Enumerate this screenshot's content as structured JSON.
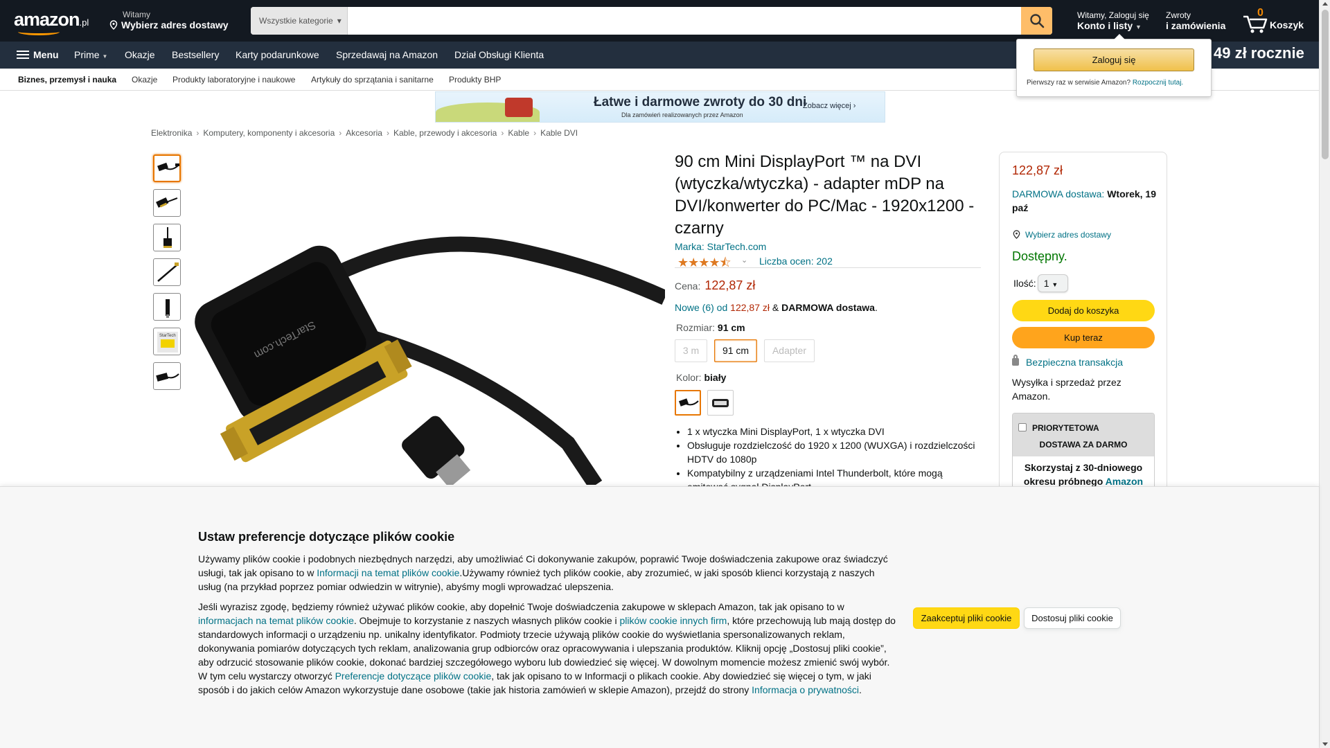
{
  "header": {
    "logo_text": "amazon",
    "logo_tld": ".pl",
    "deliver_line1": "Witamy",
    "deliver_line2": "Wybierz adres dostawy",
    "search_category": "Wszystkie kategorie",
    "search_placeholder": "",
    "account_line1": "Witamy, Zaloguj się",
    "account_line2": "Konto i listy",
    "returns_line1": "Zwroty",
    "returns_line2": "i zamówienia",
    "cart_count": "0",
    "cart_label": "Koszyk",
    "accent_color": "#febd69"
  },
  "nav": {
    "menu": "Menu",
    "prime": "Prime",
    "deals": "Okazje",
    "bestsellers": "Bestsellery",
    "gift_cards": "Karty podarunkowe",
    "sell": "Sprzedawaj na Amazon",
    "customer_service": "Dział Obsługi Klienta",
    "promo": "49 zł rocznie"
  },
  "subnav": {
    "items": [
      "Biznes, przemysł i nauka",
      "Okazje",
      "Produkty laboratoryjne i naukowe",
      "Artykuły do sprzątania i sanitarne",
      "Produkty BHP"
    ]
  },
  "banner": {
    "title": "Łatwe i darmowe zwroty do 30 dni",
    "subtitle": "Dla zamówień realizowanych przez Amazon",
    "cta": "Zobacz więcej ›"
  },
  "breadcrumb": [
    "Elektronika",
    "Komputery, komponenty i akcesoria",
    "Akcesoria",
    "Kable, przewody i akcesoria",
    "Kable",
    "Kable DVI"
  ],
  "product": {
    "title": "90 cm Mini DisplayPort ™ na DVI (wtyczka/wtyczka) - adapter mDP na DVI/konwerter do PC/Mac - 1920x1200 - czarny",
    "brand": "Marka: StarTech.com",
    "rating_stars": 4.5,
    "rating_count": "Liczba ocen: 202",
    "price_label": "Cena:",
    "price": "122,87 zł",
    "offers_prefix": "Nowe (6) od",
    "offers_price": "122,87 zł",
    "offers_amp": "&",
    "offers_free": "DARMOWA dostawa",
    "size_label": "Rozmiar:",
    "size_value": "91 cm",
    "size_options": [
      "3 m",
      "91 cm",
      "Adapter"
    ],
    "color_label": "Kolor:",
    "color_value": "biały",
    "bullets": [
      "1 x wtyczka Mini DisplayPort, 1 x wtyczka DVI",
      "Obsługuje rozdzielczość do 1920 x 1200 (WUXGA) i rozdzielczości HDTV do 1080p",
      "Kompatybilny z urządzeniami Intel Thunderbolt, które mogą emitować sygnał DisplayPort"
    ]
  },
  "buybox": {
    "price": "122,87 zł",
    "delivery_prefix": "DARMOWA dostawa:",
    "delivery_date": "Wtorek, 19 paź",
    "address_link": "Wybierz adres dostawy",
    "stock": "Dostępny.",
    "qty_label": "Ilość:",
    "qty_value": "1",
    "add_to_cart": "Dodaj do koszyka",
    "buy_now": "Kup teraz",
    "secure": "Bezpieczna transakcja",
    "shipped_by": "Wysyłka i sprzedaż przez Amazon.",
    "prime_line1": "PRIORYTETOWA",
    "prime_line2": "DOSTAWA ZA DARMO",
    "prime_body": "Skorzystaj z 30-dniowego okresu próbnego",
    "prime_link": "Amazon"
  },
  "flyout": {
    "signin": "Zaloguj się",
    "new_customer": "Pierwszy raz w serwisie Amazon?",
    "start_here": "Rozpocznij tutaj."
  },
  "cookie": {
    "title": "Ustaw preferencje dotyczące plików cookie",
    "p1_a": "Używamy plików cookie i podobnych niezbędnych narzędzi, aby umożliwiać Ci dokonywanie zakupów, poprawić Twoje doświadczenia zakupowe oraz świadczyć usługi, tak jak opisano to w ",
    "p1_link": "Informacji na temat plików cookie",
    "p1_b": ".Używamy również tych plików cookie, aby zrozumieć, w jaki sposób klienci korzystają z naszych usług (na przykład poprzez pomiar odwiedzin w witrynie), abyśmy mogli wprowadzać ulepszenia.",
    "p2_a": "Jeśli wyrazisz zgodę, będziemy również używać plików cookie, aby dopełnić Twoje doświadczenia zakupowe w sklepach Amazon, tak jak opisano to w ",
    "p2_link1": "informacjach na temat plików cookie",
    "p2_b": ". Obejmuje to korzystanie z naszych własnych plików cookie i ",
    "p2_link2": "plików cookie innych firm",
    "p2_c": ", które przechowują lub mają dostęp do standardowych informacji o urządzeniu np. unikalny identyfikator. Podmioty trzecie używają plików cookie do wyświetlania spersonalizowanych reklam, dokonywania pomiarów dotyczących tych reklam, analizowania grup odbiorców oraz opracowywania i ulepszania produktów. Kliknij opcję „Dostosuj pliki cookie”, aby odrzucić stosowanie plików cookie, dokonać bardziej szczegółowego wyboru lub dowiedzieć się więcej. W dowolnym momencie możesz zmienić swój wybór. W tym celu wystarczy otworzyć ",
    "p2_link3": "Preferencje dotyczące plików cookie",
    "p2_d": ", tak jak opisano to w Informacji o plikach cookie. Aby dowiedzieć się więcej o tym, w jaki sposób i do jakich celów Amazon wykorzystuje dane osobowe (takie jak historia zamówień w sklepie Amazon), przejdź do strony ",
    "p2_link4": "Informacja o prywatności",
    "p2_e": ".",
    "accept": "Zaakceptuj pliki cookie",
    "customize": "Dostosuj pliki cookie"
  }
}
